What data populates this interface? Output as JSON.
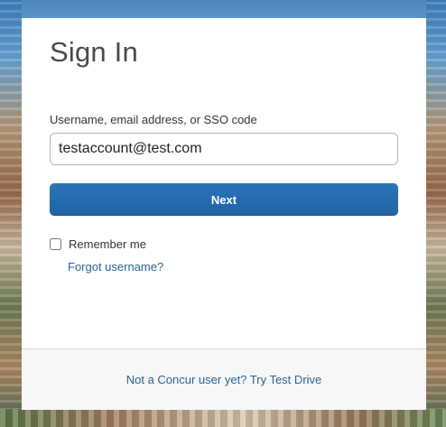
{
  "signin": {
    "title": "Sign In",
    "username_label": "Username, email address, or SSO code",
    "username_value": "testaccount@test.com",
    "next_label": "Next",
    "remember_label": "Remember me",
    "remember_checked": false,
    "forgot_label": "Forgot username?"
  },
  "footer": {
    "trial_text": "Not a Concur user yet? Try Test Drive"
  },
  "colors": {
    "primary_button": "#1f63a5",
    "link": "#2a6496",
    "footer_bg": "#f7f7f7"
  }
}
